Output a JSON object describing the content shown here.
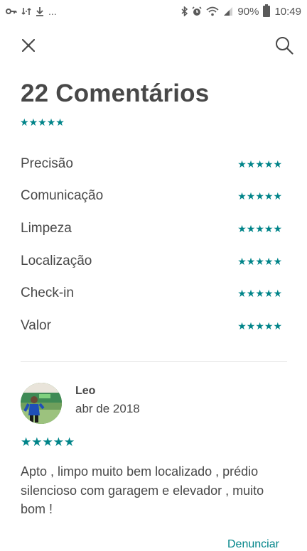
{
  "status_bar": {
    "battery": "90%",
    "time": "10:49",
    "more_indicator": "..."
  },
  "toolbar": {
    "close_icon": "close-icon",
    "search_icon": "search-icon"
  },
  "title": "22 Comentários",
  "overall_rating": 5,
  "colors": {
    "accent": "#008489",
    "text": "#484848",
    "divider": "#e4e4e4"
  },
  "categories": [
    {
      "label": "Precisão",
      "rating": 5
    },
    {
      "label": "Comunicação",
      "rating": 5
    },
    {
      "label": "Limpeza",
      "rating": 5
    },
    {
      "label": "Localização",
      "rating": 5
    },
    {
      "label": "Check-in",
      "rating": 5
    },
    {
      "label": "Valor",
      "rating": 5
    }
  ],
  "review": {
    "name": "Leo",
    "date": "abr de 2018",
    "rating": 5,
    "text": "Apto , limpo muito bem localizado , prédio silencioso com garagem e elevador , muito bom !",
    "report_label": "Denunciar"
  }
}
